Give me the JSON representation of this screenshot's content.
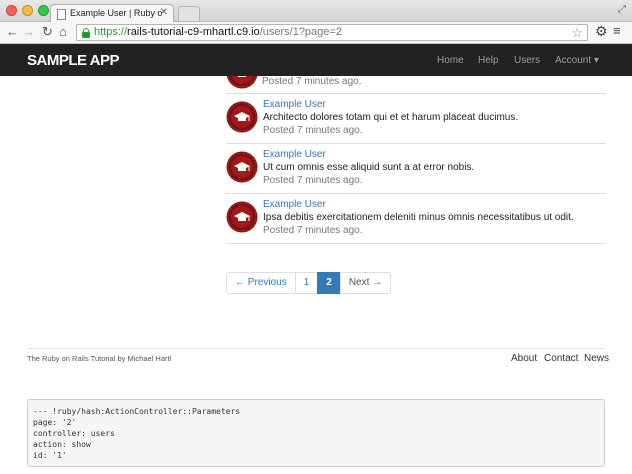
{
  "browser": {
    "tab_title": "Example User | Ruby on Ra",
    "url_scheme": "https://",
    "url_host": "rails-tutorial-c9-mhartl.c9.io",
    "url_path": "/users/1?page=2"
  },
  "header": {
    "logo": "SAMPLE APP",
    "nav": {
      "home": "Home",
      "help": "Help",
      "users": "Users",
      "account": "Account ▾"
    }
  },
  "microposts": {
    "partial_timestamp": "Posted 7 minutes ago.",
    "items": [
      {
        "user": "Example User",
        "content": "Architecto dolores totam qui et et harum placeat ducimus.",
        "timestamp": "Posted 7 minutes ago."
      },
      {
        "user": "Example User",
        "content": "Ut cum omnis esse aliquid sunt a at error nobis.",
        "timestamp": "Posted 7 minutes ago."
      },
      {
        "user": "Example User",
        "content": "Ipsa debitis exercitationem deleniti minus omnis necessitatibus ut odit.",
        "timestamp": "Posted 7 minutes ago."
      }
    ]
  },
  "pagination": {
    "previous": "← Previous",
    "page1": "1",
    "page2": "2",
    "next": "Next →",
    "current_page": 2
  },
  "footer": {
    "credit_prefix": "The ",
    "credit_link": "Ruby on Rails Tutorial",
    "credit_by": " by ",
    "credit_author": "Michael Hartl",
    "links": {
      "about": "About",
      "contact": "Contact",
      "news": "News"
    }
  },
  "debug": {
    "text": "--- !ruby/hash:ActionController::Parameters\npage: '2'\ncontroller: users\naction: show\nid: '1'"
  },
  "colors": {
    "navbar": "#222222",
    "link": "#337ab7",
    "avatar": "#a01818"
  }
}
